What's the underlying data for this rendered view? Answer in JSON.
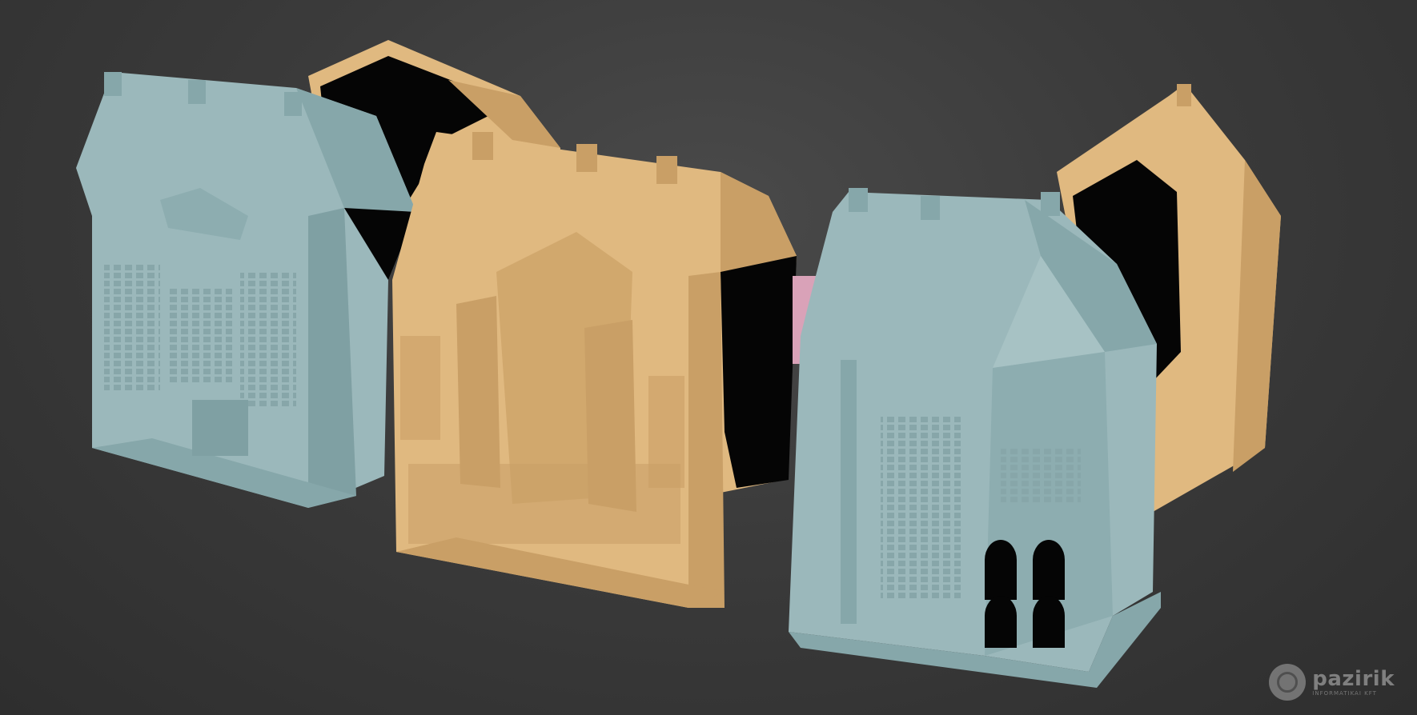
{
  "scene": {
    "background_color": "#3a3a3a",
    "palette": {
      "blue_model": "#9bb8bb",
      "blue_shade": "#7fa0a3",
      "blue_dark": "#6a8a8d",
      "tan_model": "#e0b980",
      "tan_shade": "#c99f66",
      "tan_dark": "#b28b55",
      "void": "#050505",
      "connector": "#d9a2b8"
    },
    "models": [
      {
        "name": "left-blue-building",
        "color": "blue"
      },
      {
        "name": "center-tan-building",
        "color": "tan"
      },
      {
        "name": "right-blue-corner-building",
        "color": "blue"
      },
      {
        "name": "far-right-tan-building",
        "color": "tan"
      }
    ]
  },
  "watermark": {
    "brand": "pazirik",
    "tagline": "INFORMATIKAI KFT",
    "icon": "pazirik-logo-icon"
  }
}
